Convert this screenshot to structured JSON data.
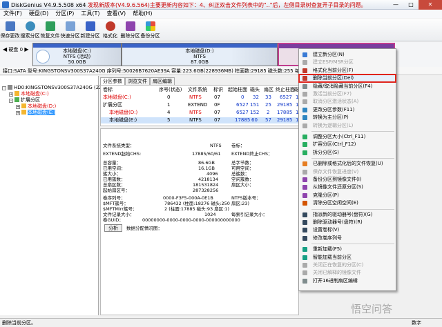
{
  "title": {
    "app": "DiskGenius V4.9.5.508 x64",
    "notice": "发现新版本(V4.9.6.564)主要更新内容如下：4、纠正双击文件列表中的\"..\"后，左侧目录树查复开子目录的问题。"
  },
  "window_controls": {
    "min": "—",
    "max": "□",
    "close": "✕"
  },
  "menu": [
    "文件(F)",
    "硬盘(D)",
    "分区(P)",
    "工具(T)",
    "查看(V)",
    "帮助(H)"
  ],
  "toolbar": [
    "保存更改",
    "搜索分区",
    "恢复文件",
    "快速分区",
    "新建分区",
    "格式化",
    "删除分区",
    "备份分区"
  ],
  "disk_nav": {
    "label": "硬盘 0",
    "up": "◀",
    "down": "▶"
  },
  "partitions": [
    {
      "name": "本地磁盘(C:)",
      "fs": "NTFS (活动)",
      "size": "50.0GB"
    },
    {
      "name": "本地磁盘(D:)",
      "fs": "NTFS",
      "size": "87.0GB"
    },
    {
      "name": "",
      "fs": "",
      "size": ""
    }
  ],
  "disk_info": "接口:SATA  型号:KINGSTONSV300S37A240G  序列号:50026B7620AE39A  容量:223.6GB(228936MB)  柱面数:29185  磁头数:255  每道扇区数:63  总扇区数:468862128",
  "tree": {
    "disk": "HD0:KINGSTONSV300S37A240G (224GB)",
    "c": "本地磁盘(C:)",
    "ext": "扩展分区",
    "d": "本地磁盘(D:)",
    "e": "本地磁盘(E:)"
  },
  "tabs": [
    "分区参数",
    "浏览文件",
    "扇区编辑"
  ],
  "table": {
    "headers": [
      "卷标",
      "序号(状态)",
      "文件系统",
      "标识",
      "起始柱面",
      "磁头",
      "扇区",
      "终止柱面",
      "磁头"
    ],
    "rows": [
      [
        "本地磁盘(C:)",
        "0",
        "NTFS",
        "07",
        "0",
        "32",
        "33",
        "6527",
        "1"
      ],
      [
        "扩展分区",
        "1",
        "EXTEND",
        "0F",
        "6527",
        "151",
        "25",
        "29185",
        "1"
      ],
      [
        "本地磁盘(D:)",
        "4",
        "NTFS",
        "07",
        "6527",
        "152",
        "2",
        "17885",
        "1"
      ],
      [
        "本地磁盘(E:)",
        "5",
        "NTFS",
        "07",
        "17885",
        "60",
        "57",
        "29185",
        "1"
      ]
    ]
  },
  "details": {
    "fs_type_label": "文件系统类型：",
    "fs_type": "NTFS",
    "vol_label": "卷标：",
    "extend_start_label": "EXTEND起始CHS:",
    "extend_start": "17885/60/61",
    "extend_end_label": "EXTEND终止CHS：",
    "left": [
      [
        "总容量：",
        "86.6GB"
      ],
      [
        "已用空间：",
        "16.1GB"
      ],
      [
        "簇大小：",
        "4096"
      ],
      [
        "已用簇数：",
        "4218134"
      ],
      [
        "总扇区数：",
        "181531824"
      ],
      [
        "起始扇区号：",
        "287328256"
      ]
    ],
    "right": [
      "总字节数：",
      "可用空间：",
      "总簇数：",
      "空闲簇数：",
      "扇区大小：",
      ""
    ],
    "lower": [
      [
        "卷序列号：",
        "0000-F3F5-000A-0E1B"
      ],
      [
        "$MFT簇号：",
        "786432 (柱面:18276 磁头:250 扇区:23)"
      ],
      [
        "$MFTMirr簇号：",
        "2 (柱面:17885 磁头:93 扇区:1)"
      ],
      [
        "文件记录大小：",
        "1024"
      ],
      [
        "卷GUID：",
        "00000000-0000-0000-0000-000000000000"
      ]
    ],
    "lower_right": [
      "NTFS版本号：",
      "",
      "",
      "每索引记录大小：",
      ""
    ],
    "analyze": "分析",
    "alloc_label": "数据分配情况图："
  },
  "context_menu": [
    {
      "label": "建立新分区(N)",
      "disabled": false,
      "icon_color": "#3a7bd5"
    },
    {
      "label": "建立ESP/MSR分区",
      "disabled": true,
      "icon_color": "#aaaaaa"
    },
    {
      "label": "格式化当前分区(F)",
      "disabled": false,
      "icon_color": "#c0392b"
    },
    {
      "label": "删除当前分区(Del)",
      "disabled": false,
      "icon_color": "#c0392b",
      "highlight": true
    },
    {
      "label": "隐藏/取消隐藏当前分区(F4)",
      "disabled": false,
      "icon_color": "#7f8c8d"
    },
    {
      "label": "激活当前分区(F7)",
      "disabled": true,
      "icon_color": "#aaaaaa"
    },
    {
      "label": "取消分区激活状态(A)",
      "disabled": true,
      "icon_color": "#aaaaaa"
    },
    {
      "label": "更改分区参数(F11)",
      "disabled": false,
      "icon_color": "#2e86c1"
    },
    {
      "label": "转换为主分区(P)",
      "disabled": false,
      "icon_color": "#2e86c1"
    },
    {
      "label": "转换为逻辑分区(L)",
      "disabled": true,
      "icon_color": "#aaaaaa"
    },
    {
      "label": "调整分区大小(Ctrl_F11)",
      "disabled": false,
      "icon_color": "#27ae60"
    },
    {
      "label": "扩容分区(Ctrl_F12)",
      "disabled": false,
      "icon_color": "#27ae60"
    },
    {
      "label": "拆分分区(S)",
      "disabled": false,
      "icon_color": "#27ae60"
    },
    {
      "label": "已删除或格式化后的文件恢复(U)",
      "disabled": false,
      "icon_color": "#e67e22"
    },
    {
      "label": "保存文件恢复进度(V)",
      "disabled": true,
      "icon_color": "#aaaaaa"
    },
    {
      "label": "备份分区到镜像文件(I)",
      "disabled": false,
      "icon_color": "#8e44ad"
    },
    {
      "label": "从镜像文件还原分区(S)",
      "disabled": false,
      "icon_color": "#8e44ad"
    },
    {
      "label": "克隆分区(P)",
      "disabled": false,
      "icon_color": "#8e44ad"
    },
    {
      "label": "清除分区空闲空间(E)",
      "disabled": false,
      "icon_color": "#d35400"
    },
    {
      "label": "指派新的驱动器号(盘符)(G)",
      "disabled": false,
      "icon_color": "#34495e"
    },
    {
      "label": "删除驱动器号(盘符)(R)",
      "disabled": false,
      "icon_color": "#34495e"
    },
    {
      "label": "设置卷标(V)",
      "disabled": false,
      "icon_color": "#34495e"
    },
    {
      "label": "修改卷序列号",
      "disabled": false,
      "icon_color": "#34495e"
    },
    {
      "label": "重新加载(F5)",
      "disabled": false,
      "icon_color": "#16a085"
    },
    {
      "label": "智能加载当前分区",
      "disabled": false,
      "icon_color": "#16a085"
    },
    {
      "label": "关闭正在恢复的分区(C)",
      "disabled": true,
      "icon_color": "#aaaaaa"
    },
    {
      "label": "关闭已解释的镜像文件",
      "disabled": true,
      "icon_color": "#aaaaaa"
    },
    {
      "label": "打开16进制扇区编辑",
      "disabled": false,
      "icon_color": "#7f8c8d"
    }
  ],
  "status": {
    "left": "删除当前分区。",
    "right": "数字"
  },
  "watermark": "悟空问答"
}
